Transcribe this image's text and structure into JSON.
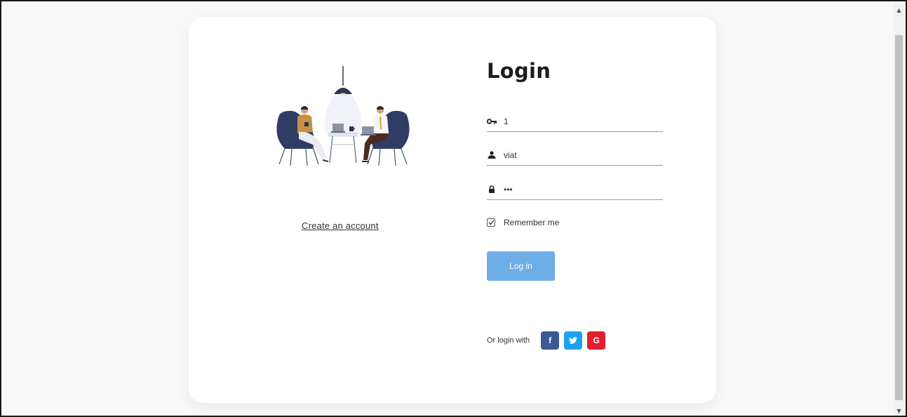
{
  "login": {
    "title": "Login",
    "fields": {
      "key_value": "1",
      "username_value": "viat",
      "password_value": "•••"
    },
    "remember_label": "Remember me",
    "remember_checked": true,
    "submit_label": "Log in",
    "social_label": "Or login with",
    "social_buttons": {
      "facebook": "f",
      "google": "G"
    }
  },
  "links": {
    "create_account": "Create an account"
  },
  "icons": {
    "key": "key-icon",
    "user": "user-icon",
    "lock": "lock-icon",
    "check": "check-icon",
    "twitter": "twitter-bird-icon"
  },
  "colors": {
    "primary_button": "#6eaee6",
    "facebook": "#3b5998",
    "twitter": "#1da1f2",
    "google": "#e0202f"
  }
}
